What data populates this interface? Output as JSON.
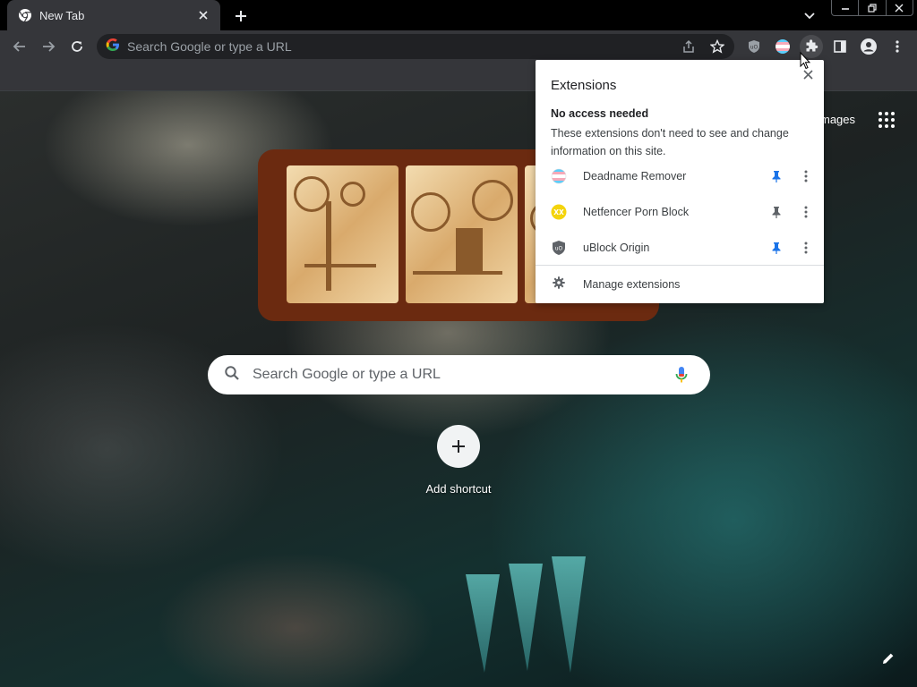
{
  "tab": {
    "title": "New Tab"
  },
  "omnibox": {
    "placeholder": "Search Google or type a URL"
  },
  "ntp": {
    "top_link": "mages",
    "search_placeholder": "Search Google or type a URL",
    "shortcut_label": "Add shortcut"
  },
  "extensions_popup": {
    "title": "Extensions",
    "section_title": "No access needed",
    "section_desc": "These extensions don't need to see and change information on this site.",
    "items": [
      {
        "name": "Deadname Remover",
        "icon": "trans-flag-icon",
        "pinned": true
      },
      {
        "name": "Netfencer Porn Block",
        "icon": "netfencer-icon",
        "pinned": false
      },
      {
        "name": "uBlock Origin",
        "icon": "ublock-shield-icon",
        "pinned": true
      }
    ],
    "manage_label": "Manage extensions"
  },
  "colors": {
    "tabstrip": "#000000",
    "toolbar": "#35363a",
    "omnibox": "#202124",
    "doodle_frame": "#6b2a10",
    "pin_active": "#1a73e8",
    "pin_inactive": "#5f6368"
  }
}
